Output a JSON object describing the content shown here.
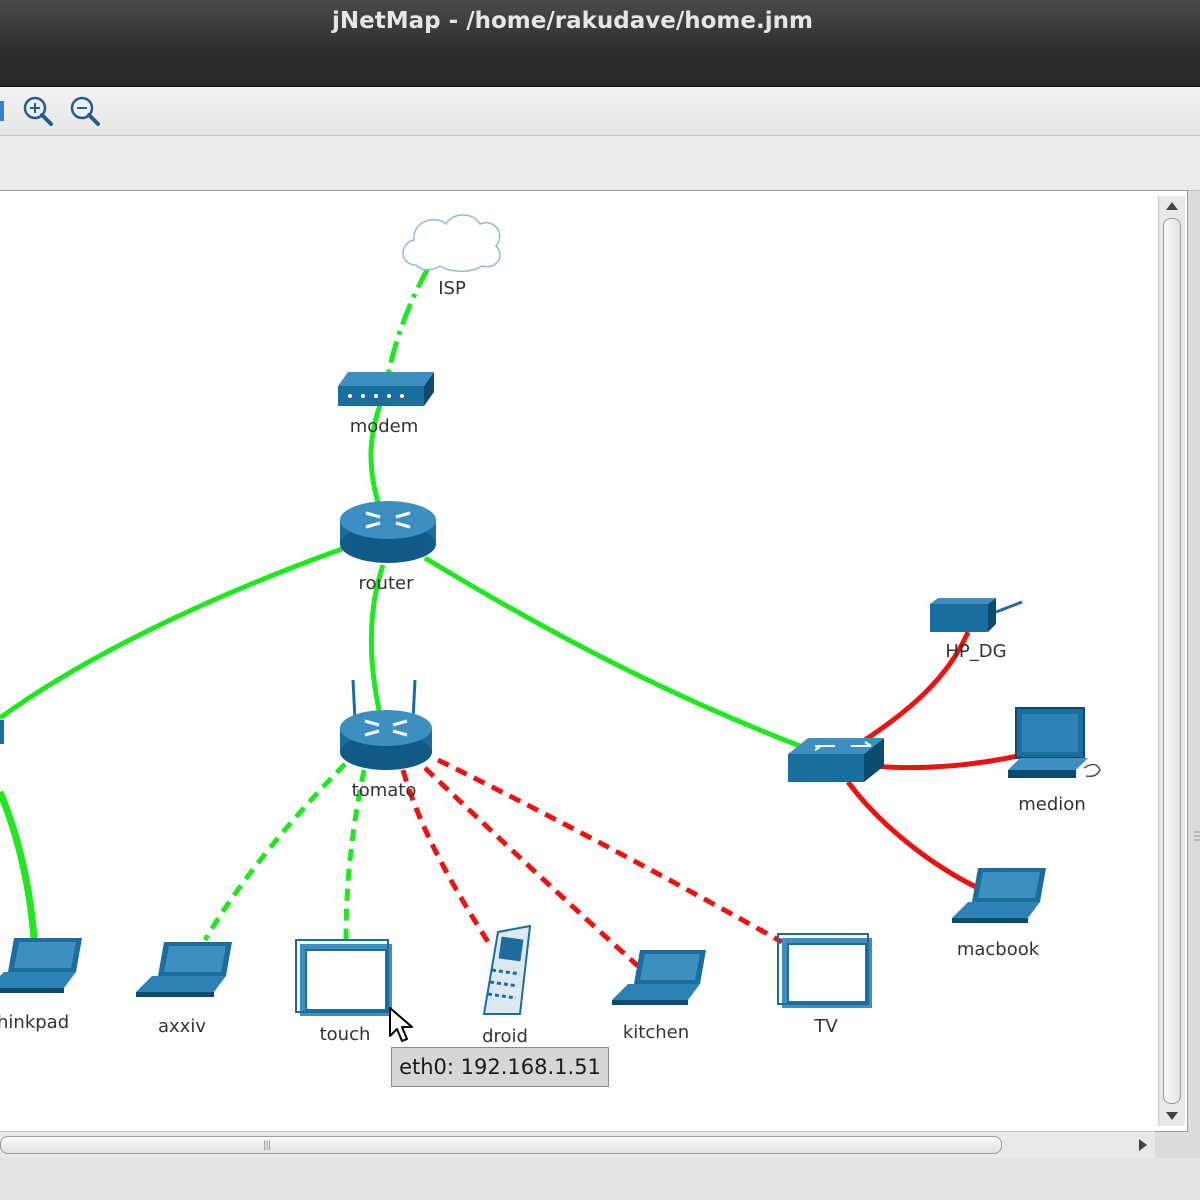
{
  "window": {
    "title": "jNetMap - /home/rakudave/home.jnm"
  },
  "toolbar": {
    "buttons": [
      {
        "name": "zoom-in-button",
        "icon": "zoom-in-icon"
      },
      {
        "name": "zoom-out-button",
        "icon": "zoom-out-icon"
      }
    ]
  },
  "colors": {
    "link_up": "#1ee81e",
    "link_down": "#ee1111",
    "device": "#1a6e9e",
    "device_dark": "#0c4b6e"
  },
  "nodes": [
    {
      "id": "isp",
      "label": "ISP",
      "type": "cloud"
    },
    {
      "id": "modem",
      "label": "modem",
      "type": "modem"
    },
    {
      "id": "router",
      "label": "router",
      "type": "router"
    },
    {
      "id": "tomato",
      "label": "tomato",
      "type": "wireless-router"
    },
    {
      "id": "hp_dg",
      "label": "HP_DG",
      "type": "printer"
    },
    {
      "id": "medion",
      "label": "medion",
      "type": "workstation"
    },
    {
      "id": "switch",
      "label": "",
      "type": "switch"
    },
    {
      "id": "macbook",
      "label": "macbook",
      "type": "laptop"
    },
    {
      "id": "thinkpad",
      "label": "hinkpad",
      "type": "laptop"
    },
    {
      "id": "axxiv",
      "label": "axxiv",
      "type": "laptop"
    },
    {
      "id": "touch",
      "label": "touch",
      "type": "screen"
    },
    {
      "id": "droid",
      "label": "droid",
      "type": "phone"
    },
    {
      "id": "kitchen",
      "label": "kitchen",
      "type": "laptop"
    },
    {
      "id": "tv",
      "label": "TV",
      "type": "screen"
    }
  ],
  "links": [
    {
      "from": "isp",
      "to": "modem",
      "status": "up",
      "style": "dashdot"
    },
    {
      "from": "modem",
      "to": "router",
      "status": "up",
      "style": "solid"
    },
    {
      "from": "router",
      "to": "tomato",
      "status": "up",
      "style": "solid"
    },
    {
      "from": "router",
      "to": "switch",
      "status": "up",
      "style": "solid"
    },
    {
      "from": "router",
      "to": "left-offscreen",
      "status": "up",
      "style": "solid"
    },
    {
      "from": "left-offscreen",
      "to": "thinkpad",
      "status": "up",
      "style": "solid"
    },
    {
      "from": "switch",
      "to": "hp_dg",
      "status": "down",
      "style": "solid"
    },
    {
      "from": "switch",
      "to": "medion",
      "status": "down",
      "style": "solid"
    },
    {
      "from": "switch",
      "to": "macbook",
      "status": "down",
      "style": "solid"
    },
    {
      "from": "tomato",
      "to": "axxiv",
      "status": "up",
      "style": "dashed"
    },
    {
      "from": "tomato",
      "to": "touch",
      "status": "up",
      "style": "dashed"
    },
    {
      "from": "tomato",
      "to": "droid",
      "status": "down",
      "style": "dashed"
    },
    {
      "from": "tomato",
      "to": "kitchen",
      "status": "down",
      "style": "dashed"
    },
    {
      "from": "tomato",
      "to": "tv",
      "status": "down",
      "style": "dashed"
    }
  ],
  "tooltip": {
    "text": "eth0: 192.168.1.51"
  }
}
